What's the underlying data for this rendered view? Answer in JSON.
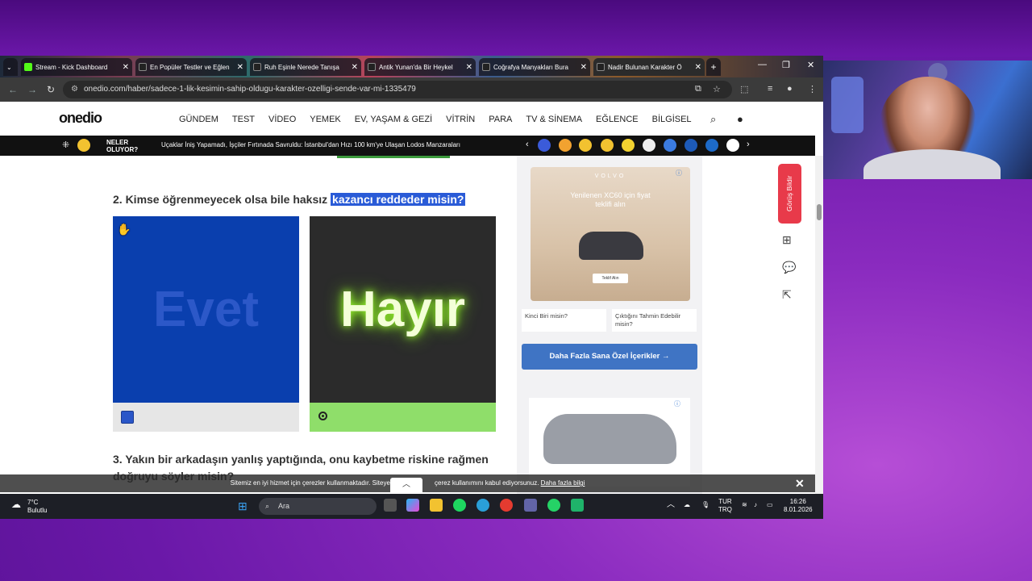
{
  "browser": {
    "tabs": [
      {
        "title": "Stream - Kick Dashboard",
        "color": "#53fc18"
      },
      {
        "title": "En Popüler Testler ve Eğlen",
        "color": "#222222"
      },
      {
        "title": "Ruh Eşinle Nerede Tanışa",
        "color": "#222222"
      },
      {
        "title": "Antik Yunan'da Bir Heykel",
        "color": "#222222"
      },
      {
        "title": "Coğrafya Manyakları Bura",
        "color": "#222222"
      },
      {
        "title": "Nadir Bulunan Karakter Ö",
        "color": "#222222"
      }
    ],
    "new_tab": "+",
    "window_controls": [
      "—",
      "❐",
      "✕"
    ],
    "url": "onedio.com/haber/sadece-1-lik-kesimin-sahip-oldugu-karakter-ozelligi-sende-var-mi-1335479"
  },
  "site": {
    "logo": "onedio",
    "nav": [
      "GÜNDEM",
      "TEST",
      "VİDEO",
      "YEMEK",
      "EV, YAŞAM & GEZİ",
      "VİTRİN",
      "PARA",
      "TV & SİNEMA",
      "EĞLENCE",
      "BİLGİSEL"
    ],
    "ticker_label_1": "NELER",
    "ticker_label_2": "OLUYOR?",
    "ticker_news": "Uçaklar İniş Yapamadı, İşçiler Fırtınada Savruldu: İstanbul'dan Hızı 100 km'ye Ulaşan Lodos Manzaraları"
  },
  "quiz": {
    "q2_prefix": "2. Kimse öğrenmeyecek olsa bile haksız ",
    "q2_highlight": "kazancı reddeder misin?",
    "option_yes": "Evet",
    "option_no": "Hayır",
    "q3": "3. Yakın bir arkadaşın yanlış yaptığında, onu kaybetme riskine rağmen doğruyu söyler misin?"
  },
  "sidebar": {
    "ad_brand": "VOLVO",
    "ad_text": "Yenilenen XC60 için fiyat teklifi alın",
    "ad_button": "Teklif Alın",
    "teaser_1": "Kinci Biri misin?",
    "teaser_2": "Çıktığını Tahmin Edebilir misin?",
    "more_button": "Daha Fazla Sana Özel İçerikler →"
  },
  "side_actions": {
    "feedback": "Görüş Bildir"
  },
  "cookie": {
    "text_1": "Sitemiz en iyi hizmet için çerezler kullanmaktadır. Siteye gir",
    "text_2": "çerez kullanımını kabul ediyorsunuz.",
    "link": "Daha fazla bilgi",
    "close": "✕"
  },
  "taskbar": {
    "temp": "7°C",
    "weather": "Bulutlu",
    "search_placeholder": "Ara",
    "lang_1": "TUR",
    "lang_2": "TRQ",
    "time": "16:26",
    "date": "8.01.2026"
  }
}
